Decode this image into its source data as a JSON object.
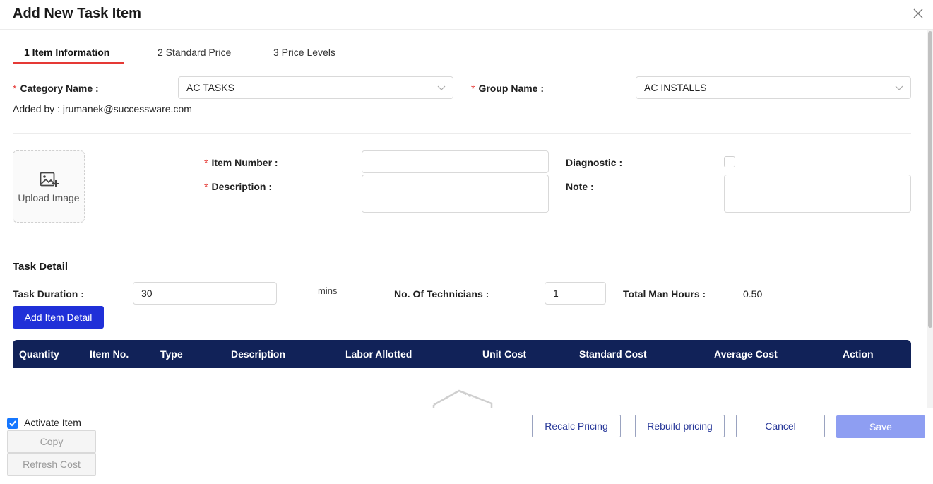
{
  "header": {
    "title": "Add New Task Item"
  },
  "tabs": [
    {
      "label": "1 Item Information",
      "active": true
    },
    {
      "label": "2 Standard Price",
      "active": false
    },
    {
      "label": "3 Price Levels",
      "active": false
    }
  ],
  "category": {
    "required_mark": "*",
    "label": "Category Name",
    "value": "AC TASKS"
  },
  "group": {
    "required_mark": "*",
    "label": "Group Name",
    "value": "AC INSTALLS"
  },
  "added_by": {
    "text": "Added by : jrumanek@successware.com"
  },
  "upload": {
    "label": "Upload Image",
    "icon": "image-add-icon"
  },
  "item_number": {
    "required_mark": "*",
    "label": "Item Number",
    "value": ""
  },
  "description": {
    "required_mark": "*",
    "label": "Description",
    "value": ""
  },
  "diagnostic": {
    "label": "Diagnostic",
    "checked": false
  },
  "note": {
    "label": "Note",
    "value": ""
  },
  "task_detail": {
    "title": "Task Detail",
    "duration_label": "Task Duration",
    "duration_value": "30",
    "duration_unit": "mins",
    "technicians_label": "No. Of Technicians",
    "technicians_value": "1",
    "man_hours_label": "Total Man Hours",
    "man_hours_value": "0.50",
    "add_button": "Add Item Detail"
  },
  "table": {
    "columns": [
      "Quantity",
      "Item No.",
      "Type",
      "Description",
      "Labor Allotted",
      "Unit Cost",
      "Standard Cost",
      "Average Cost",
      "Action"
    ],
    "rows": [],
    "empty_icon": "empty-box-icon"
  },
  "footer": {
    "activate_label": "Activate Item",
    "activate_checked": true,
    "copy_label": "Copy",
    "refresh_label": "Refresh Cost",
    "recalc_label": "Recalc Pricing",
    "rebuild_label": "Rebuild pricing",
    "cancel_label": "Cancel",
    "save_label": "Save"
  },
  "colors": {
    "accent_blue": "#2030d8",
    "table_header": "#112258",
    "tab_underline": "#e53935",
    "required": "#e53935",
    "save_disabled": "#8e9ef2"
  }
}
